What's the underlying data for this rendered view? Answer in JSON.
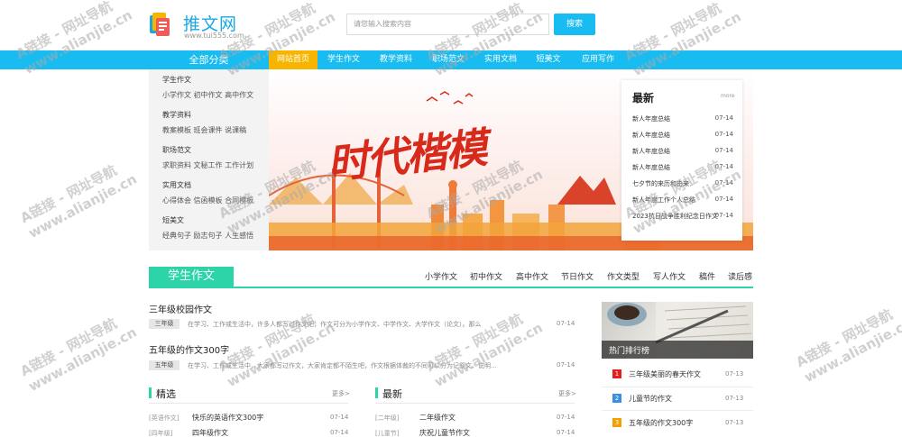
{
  "header": {
    "site_name": "推文网",
    "site_domain": "www.tui555.com",
    "search_placeholder": "请您输入搜索内容",
    "search_button": "搜索"
  },
  "nav": {
    "all_categories": "全部分类",
    "items": [
      "网站首页",
      "学生作文",
      "教学资料",
      "职场范文",
      "实用文档",
      "短美文",
      "应用写作"
    ],
    "active_index": 0
  },
  "categories": [
    {
      "title": "学生作文",
      "links": "小学作文 初中作文 高中作文"
    },
    {
      "title": "教学资料",
      "links": "教案模板 班会课件 说课稿"
    },
    {
      "title": "职场范文",
      "links": "求职资料 文秘工作 工作计划"
    },
    {
      "title": "实用文档",
      "links": "心得体会 信函模板 合同模板"
    },
    {
      "title": "短美文",
      "links": "经典句子 励志句子 人生感悟"
    }
  ],
  "banner": {
    "text": "时代楷模"
  },
  "latest": {
    "title": "最新",
    "more": "more",
    "items": [
      {
        "text": "新人年度总结",
        "date": "07-14"
      },
      {
        "text": "新人年度总结",
        "date": "07-14"
      },
      {
        "text": "新人年度总结",
        "date": "07-14"
      },
      {
        "text": "新人年度总结",
        "date": "07-14"
      },
      {
        "text": "七夕节的来历和由来",
        "date": "07-14"
      },
      {
        "text": "新人年度工作个人总结",
        "date": "07-14"
      },
      {
        "text": "2023抗日战争胜利纪念日作文",
        "date": "07-14"
      }
    ]
  },
  "section": {
    "title": "学生作文",
    "links": [
      "小学作文",
      "初中作文",
      "高中作文",
      "节日作文",
      "作文类型",
      "写人作文",
      "稿件",
      "读后感"
    ]
  },
  "articles": [
    {
      "title": "三年级校园作文",
      "tag": "三年级",
      "desc": "在学习、工作或生活中，许多人都写过作文吧，作文可分为小学作文、中学作文、大学作文（论文）。那么",
      "date": "07-14"
    },
    {
      "title": "五年级的作文300字",
      "tag": "五年级",
      "desc": "在学习、工作或生活中，大家都写过作文，大家肯定都不陌生吧，作文根据体裁的不同可以分为记叙文、说明…",
      "date": "07-14"
    }
  ],
  "featured": {
    "title": "精选",
    "more": "更多>",
    "items": [
      {
        "cat": "[英语作文]",
        "text": "快乐的英语作文300字",
        "date": "07-14"
      },
      {
        "cat": "[四年级]",
        "text": "四年级作文",
        "date": "07-14"
      }
    ]
  },
  "newest": {
    "title": "最新",
    "more": "更多>",
    "items": [
      {
        "cat": "[二年级]",
        "text": "二年级作文",
        "date": "07-14"
      },
      {
        "cat": "[儿童节]",
        "text": "庆祝儿童节作文",
        "date": "07-14"
      }
    ]
  },
  "hot": {
    "title": "热门排行榜",
    "items": [
      {
        "num": "1",
        "text": "三年级美丽的春天作文",
        "date": "07-13",
        "color": "#e02020"
      },
      {
        "num": "2",
        "text": "儿童节的作文",
        "date": "07-13",
        "color": "#3b8fe0"
      },
      {
        "num": "3",
        "text": "五年级的作文300字",
        "date": "07-13",
        "color": "#f4a000"
      }
    ]
  },
  "watermark": {
    "line1": "A链接 - 网址导航",
    "line2": "www.alianjie.cn"
  },
  "colors": {
    "nav": "#19bcf0",
    "nav_active": "#f7b500",
    "accent": "#2dd4a8"
  }
}
